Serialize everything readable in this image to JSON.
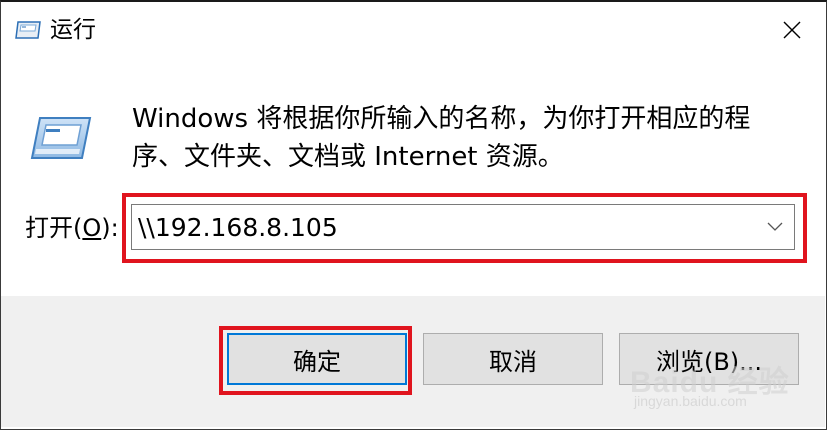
{
  "window": {
    "title": "运行",
    "close_icon": "close-icon",
    "run_icon": "run-app-icon"
  },
  "content": {
    "description": "Windows 将根据你所输入的名称，为你打开相应的程序、文件夹、文档或 Internet 资源。",
    "open_label_prefix": "打开(",
    "open_label_accel": "O",
    "open_label_suffix": "):",
    "input_value": "\\\\192.168.8.105"
  },
  "buttons": {
    "ok_label": "确定",
    "cancel_label": "取消",
    "browse_label": "浏览(B)..."
  },
  "watermark": {
    "brand": "Baidu 经验",
    "url": "jingyan.baidu.com"
  },
  "colors": {
    "highlight": "#e0141e",
    "primary_button_border": "#0078d7",
    "footer_bg": "#f0f0f0",
    "button_bg": "#e1e1e1"
  }
}
